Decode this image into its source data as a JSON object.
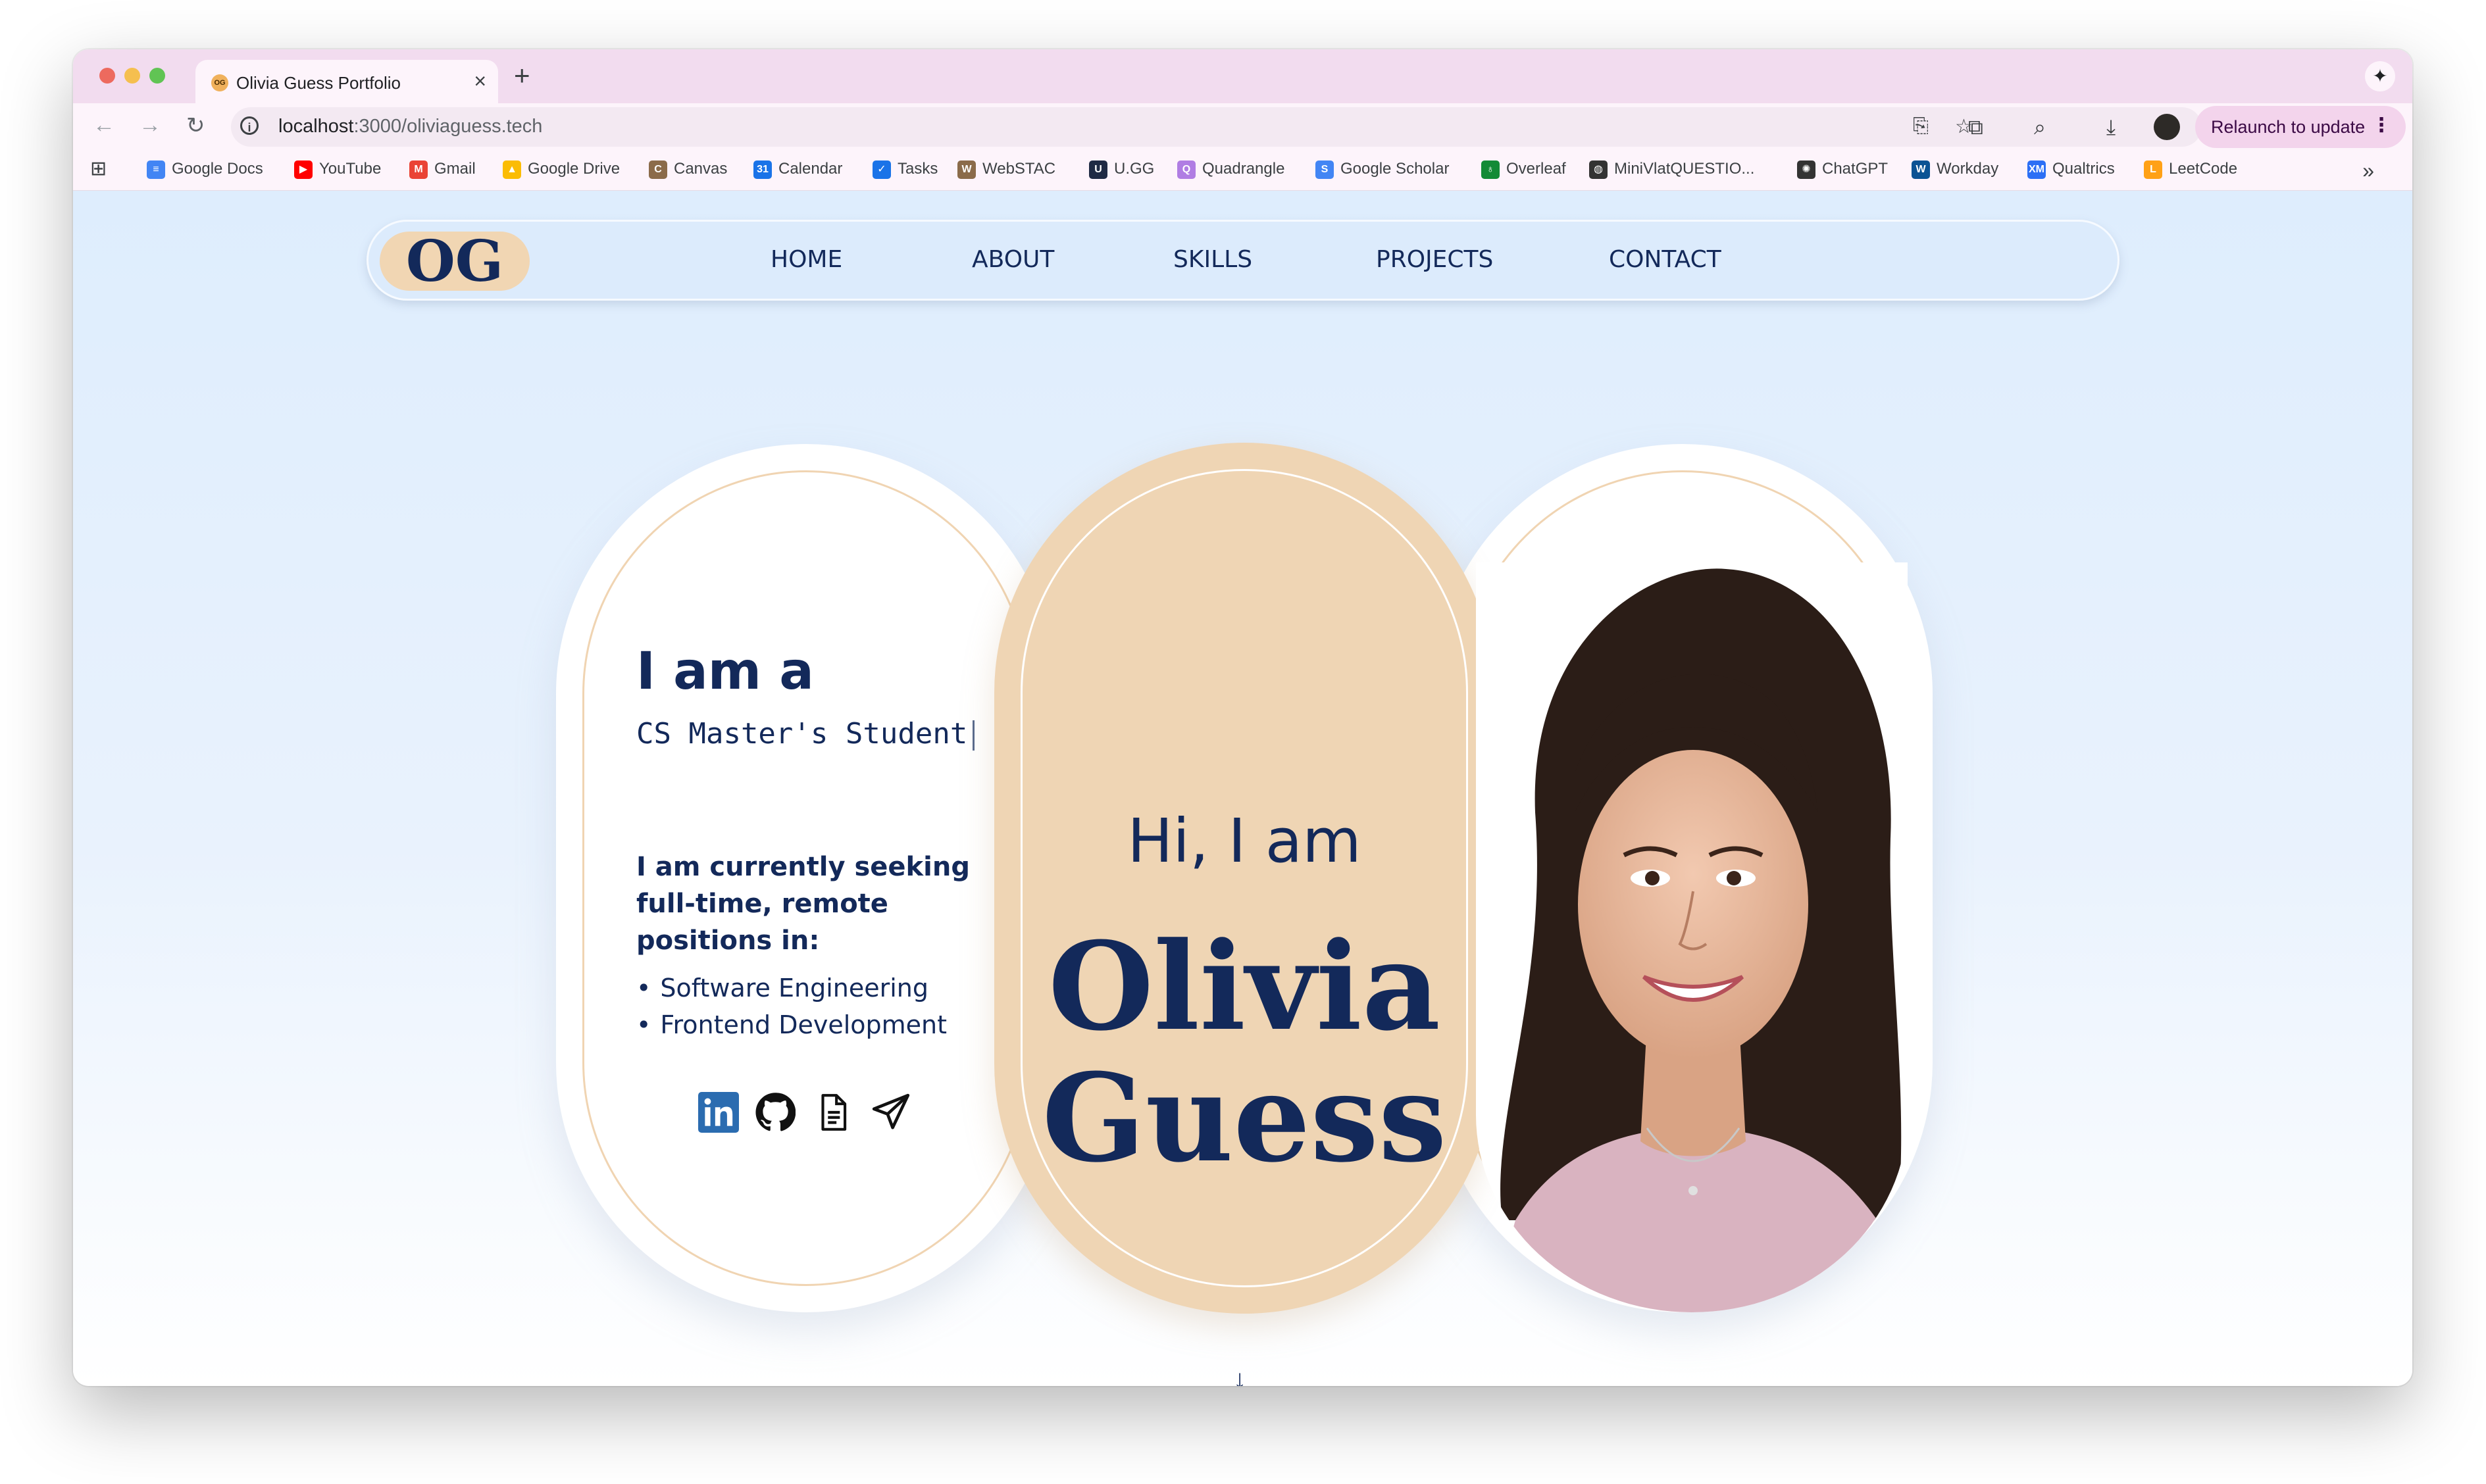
{
  "browser": {
    "tab_title": "Olivia Guess Portfolio",
    "tab_favicon_text": "OG",
    "url_host": "localhost",
    "url_path": ":3000/oliviaguess.tech",
    "relaunch_label": "Relaunch to update",
    "bookmarks": [
      {
        "label": "Google Docs",
        "icon": "docs-icon",
        "color": "#4285f4"
      },
      {
        "label": "YouTube",
        "icon": "youtube-icon",
        "color": "#ff0000"
      },
      {
        "label": "Gmail",
        "icon": "gmail-icon",
        "color": "#ea4335"
      },
      {
        "label": "Google Drive",
        "icon": "drive-icon",
        "color": "#fbbc04"
      },
      {
        "label": "Canvas",
        "icon": "canvas-icon",
        "color": "#8b6b4a"
      },
      {
        "label": "Calendar",
        "icon": "calendar-icon",
        "color": "#1a73e8"
      },
      {
        "label": "Tasks",
        "icon": "tasks-icon",
        "color": "#1a73e8"
      },
      {
        "label": "WebSTAC",
        "icon": "webstac-icon",
        "color": "#8b6b4a"
      },
      {
        "label": "U.GG",
        "icon": "ugg-icon",
        "color": "#1f2a44"
      },
      {
        "label": "Quadrangle",
        "icon": "quadrangle-icon",
        "color": "#b07de3"
      },
      {
        "label": "Google Scholar",
        "icon": "scholar-icon",
        "color": "#4285f4"
      },
      {
        "label": "Overleaf",
        "icon": "overleaf-icon",
        "color": "#138a36"
      },
      {
        "label": "MiniVlatQUESTIO...",
        "icon": "globe-icon",
        "color": "#333333"
      },
      {
        "label": "ChatGPT",
        "icon": "chatgpt-icon",
        "color": "#333333"
      },
      {
        "label": "Workday",
        "icon": "workday-icon",
        "color": "#0b5394"
      },
      {
        "label": "Qualtrics",
        "icon": "qualtrics-icon",
        "color": "#2c6ff5"
      },
      {
        "label": "LeetCode",
        "icon": "leetcode-icon",
        "color": "#ffa116"
      }
    ]
  },
  "site": {
    "logo": "OG",
    "nav": [
      "HOME",
      "ABOUT",
      "SKILLS",
      "PROJECTS",
      "CONTACT"
    ],
    "intro": {
      "heading": "I am a",
      "typed_role": "CS Master's Student",
      "seeking": "I am currently seeking full-time, remote positions in:",
      "positions": [
        "Software Engineering",
        "Frontend Development"
      ],
      "socials": [
        "linkedin-icon",
        "github-icon",
        "resume-icon",
        "send-icon"
      ]
    },
    "hero": {
      "greeting": "Hi, I am",
      "first_name": "Olivia",
      "last_name": "Guess"
    },
    "colors": {
      "navy": "#13295a",
      "peach": "#efd5b4",
      "sky": "#deedfd"
    }
  }
}
